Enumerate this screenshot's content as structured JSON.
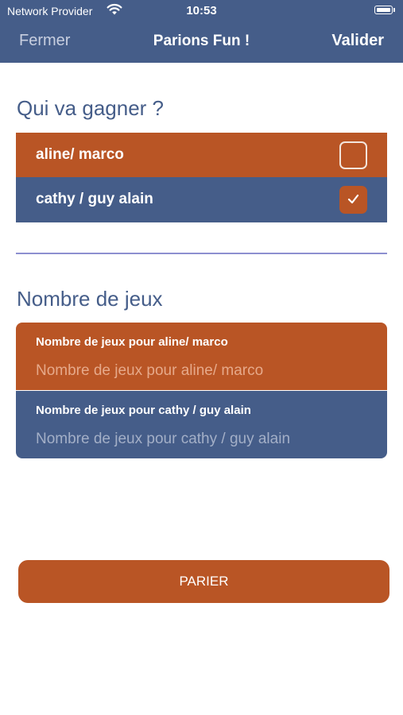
{
  "status_bar": {
    "carrier": "Network Provider",
    "time": "10:53"
  },
  "nav": {
    "close_label": "Fermer",
    "title": "Parions Fun !",
    "confirm_label": "Valider"
  },
  "winner_section": {
    "heading": "Qui va gagner ?",
    "options": [
      {
        "label": "aline/ marco",
        "checked": false
      },
      {
        "label": "cathy / guy alain",
        "checked": true
      }
    ]
  },
  "games_section": {
    "heading": "Nombre de jeux",
    "fields": [
      {
        "label": "Nombre de jeux pour aline/ marco",
        "placeholder": "Nombre de jeux pour aline/ marco",
        "value": ""
      },
      {
        "label": "Nombre de jeux pour cathy / guy alain",
        "placeholder": "Nombre de jeux pour cathy / guy alain",
        "value": ""
      }
    ]
  },
  "submit_label": "PARIER",
  "colors": {
    "primary_blue": "#455d89",
    "accent_orange": "#b95525",
    "divider": "#8d8fd0"
  }
}
